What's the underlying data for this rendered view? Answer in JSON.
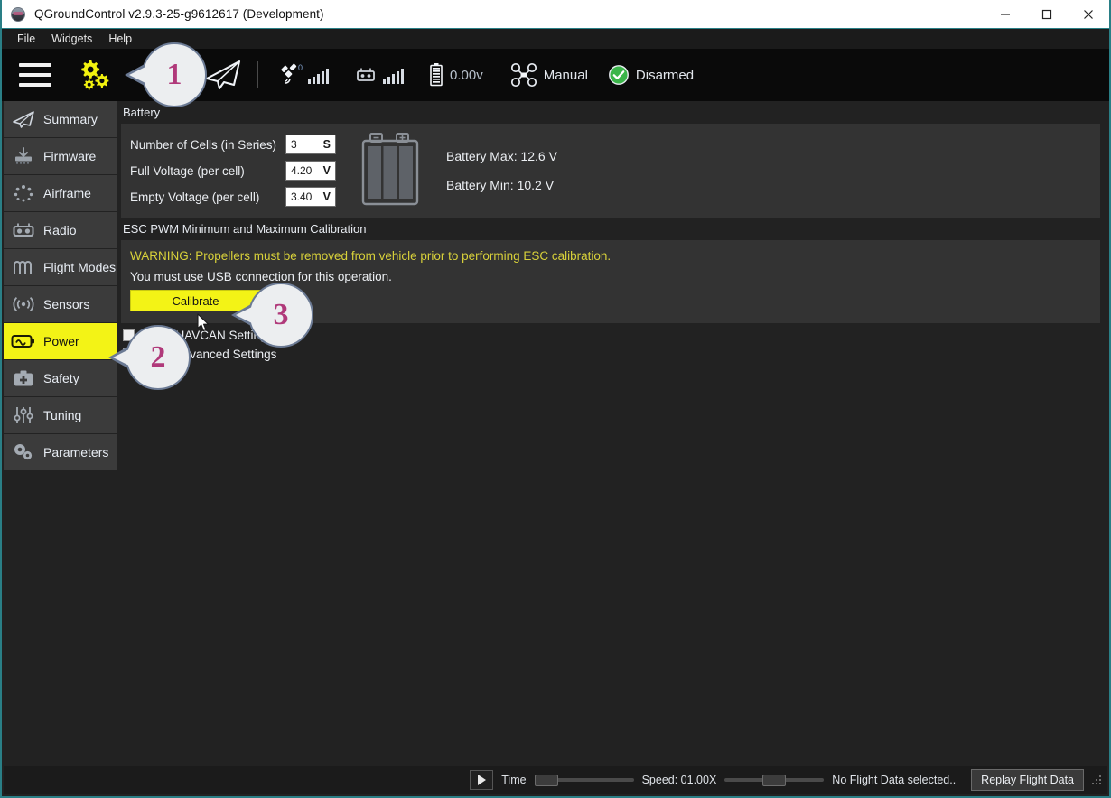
{
  "window": {
    "title": "QGroundControl v2.9.3-25-g9612617 (Development)",
    "app_icon": "qgroundcontrol-logo-icon",
    "controls": {
      "minimize": "minimize-icon",
      "maximize": "maximize-icon",
      "close": "close-icon"
    },
    "accent_border": "#2a7f86"
  },
  "menubar": {
    "items": [
      {
        "label": "File"
      },
      {
        "label": "Widgets"
      },
      {
        "label": "Help"
      }
    ]
  },
  "toolbar": {
    "menu_icon": "hamburger-menu-icon",
    "settings_icon": "gears-icon",
    "fly_icon": "paper-plane-icon",
    "gps": {
      "icon": "satellite-icon",
      "count": "0",
      "signal_bars": 5
    },
    "rc": {
      "icon": "rc-transmitter-icon",
      "signal_bars": 5
    },
    "battery": {
      "icon": "battery-icon",
      "voltage": "0.00v"
    },
    "flight_mode": {
      "icon": "quadrotor-icon",
      "label": "Manual"
    },
    "armed_state": {
      "icon": "check-circle-icon",
      "label": "Disarmed",
      "color": "#3bb54a"
    }
  },
  "sidebar": {
    "items": [
      {
        "label": "Summary",
        "icon": "paper-plane-icon",
        "active": false
      },
      {
        "label": "Firmware",
        "icon": "download-chip-icon",
        "active": false
      },
      {
        "label": "Airframe",
        "icon": "airframe-dots-icon",
        "active": false
      },
      {
        "label": "Radio",
        "icon": "rc-transmitter-icon",
        "active": false
      },
      {
        "label": "Flight Modes",
        "icon": "waveform-icon",
        "active": false
      },
      {
        "label": "Sensors",
        "icon": "sensor-waves-icon",
        "active": false
      },
      {
        "label": "Power",
        "icon": "battery-icon",
        "active": true
      },
      {
        "label": "Safety",
        "icon": "first-aid-kit-icon",
        "active": false
      },
      {
        "label": "Tuning",
        "icon": "sliders-icon",
        "active": false
      },
      {
        "label": "Parameters",
        "icon": "gears-icon",
        "active": false
      }
    ],
    "active_color": "#f3f316"
  },
  "main": {
    "battery_section": {
      "title": "Battery",
      "fields": [
        {
          "label": "Number of Cells (in Series)",
          "value": "3",
          "unit": "S"
        },
        {
          "label": "Full Voltage (per cell)",
          "value": "4.20",
          "unit": "V"
        },
        {
          "label": "Empty Voltage (per cell)",
          "value": "3.40",
          "unit": "V"
        }
      ],
      "graphic": "battery-3-cell-icon",
      "readouts": [
        {
          "label": "Battery Max: 12.6 V"
        },
        {
          "label": "Battery Min:  10.2 V"
        }
      ]
    },
    "esc_section": {
      "title": "ESC PWM Minimum and Maximum Calibration",
      "warning": "WARNING: Propellers must be removed from vehicle prior to performing ESC calibration.",
      "warning_color": "#d8d13a",
      "note": "You must use USB connection for this operation.",
      "calibrate_label": "Calibrate",
      "calibrate_color": "#f3f316"
    },
    "checkboxes": [
      {
        "label": "Show UAVCAN Settings",
        "checked": false
      },
      {
        "label": "Show Advanced Settings",
        "checked": false
      }
    ]
  },
  "statusbar": {
    "play_icon": "play-icon",
    "time_label": "Time",
    "speed_label": "Speed: 01.00X",
    "flight_data_label": "No Flight Data selected..",
    "replay_button": "Replay Flight Data",
    "resize_grip": "resize-grip-icon"
  },
  "callouts": [
    {
      "number": "1",
      "target": "settings-gears-toolbar-button"
    },
    {
      "number": "2",
      "target": "power-sidebar-item"
    },
    {
      "number": "3",
      "target": "calibrate-button"
    }
  ]
}
